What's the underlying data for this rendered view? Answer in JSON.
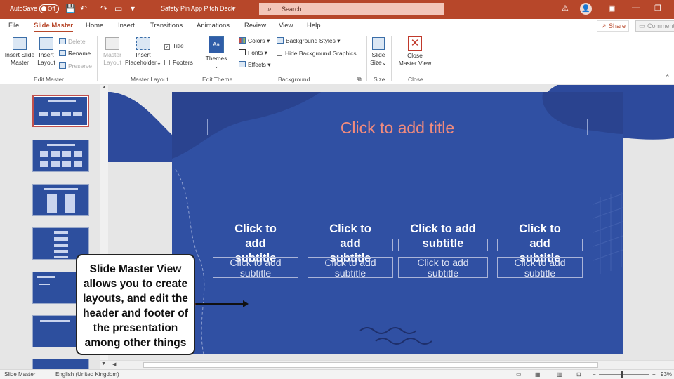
{
  "titlebar": {
    "autosave_label": "AutoSave",
    "autosave_state": "Off",
    "doc_title": "Safety Pin App Pitch Deck",
    "search_placeholder": "Search",
    "accent": "#b7472a"
  },
  "tabs": [
    "File",
    "Slide Master",
    "Home",
    "Insert",
    "Transitions",
    "Animations",
    "Review",
    "View",
    "Help"
  ],
  "tab_active": "Slide Master",
  "share_label": "Share",
  "comments_label": "Comments",
  "ribbon": {
    "edit_master": {
      "insert_slide_master": [
        "Insert Slide",
        "Master"
      ],
      "insert_layout": [
        "Insert",
        "Layout"
      ],
      "delete": "Delete",
      "rename": "Rename",
      "preserve": "Preserve",
      "group": "Edit Master"
    },
    "master_layout": {
      "master_layout_btn": [
        "Master",
        "Layout"
      ],
      "insert_placeholder": [
        "Insert",
        "Placeholder"
      ],
      "title_chk": "Title",
      "footers_chk": "Footers",
      "title_checked": "✓",
      "group": "Master Layout"
    },
    "edit_theme": {
      "themes": "Themes",
      "group": "Edit Theme"
    },
    "background": {
      "colors": "Colors",
      "fonts": "Fonts",
      "effects": "Effects",
      "bg_styles": "Background Styles",
      "hide_bg": "Hide Background Graphics",
      "group": "Background"
    },
    "size": {
      "slide_size": [
        "Slide",
        "Size"
      ],
      "group": "Size"
    },
    "close": {
      "close_master": [
        "Close",
        "Master View"
      ],
      "group": "Close"
    }
  },
  "slide": {
    "title_placeholder": "Click to add title",
    "columns": [
      {
        "heading": [
          "Click to",
          "add",
          "subtitle"
        ],
        "sub": [
          "Click to add",
          "subtitle"
        ]
      },
      {
        "heading": [
          "Click to",
          "add",
          "subtitle"
        ],
        "sub": [
          "Click to add",
          "subtitle"
        ]
      },
      {
        "heading": [
          "Click to add",
          "subtitle"
        ],
        "sub": [
          "Click to add",
          "subtitle"
        ]
      },
      {
        "heading": [
          "Click to",
          "add",
          "subtitle"
        ],
        "sub": [
          "Click to add",
          "subtitle"
        ]
      }
    ]
  },
  "callout": {
    "lines": [
      "Slide Master View",
      "allows you to create",
      "layouts, and edit the",
      "header and footer of",
      "the presentation",
      "among other things"
    ]
  },
  "statusbar": {
    "mode": "Slide Master",
    "language": "English (United Kingdom)",
    "zoom": "93%"
  }
}
